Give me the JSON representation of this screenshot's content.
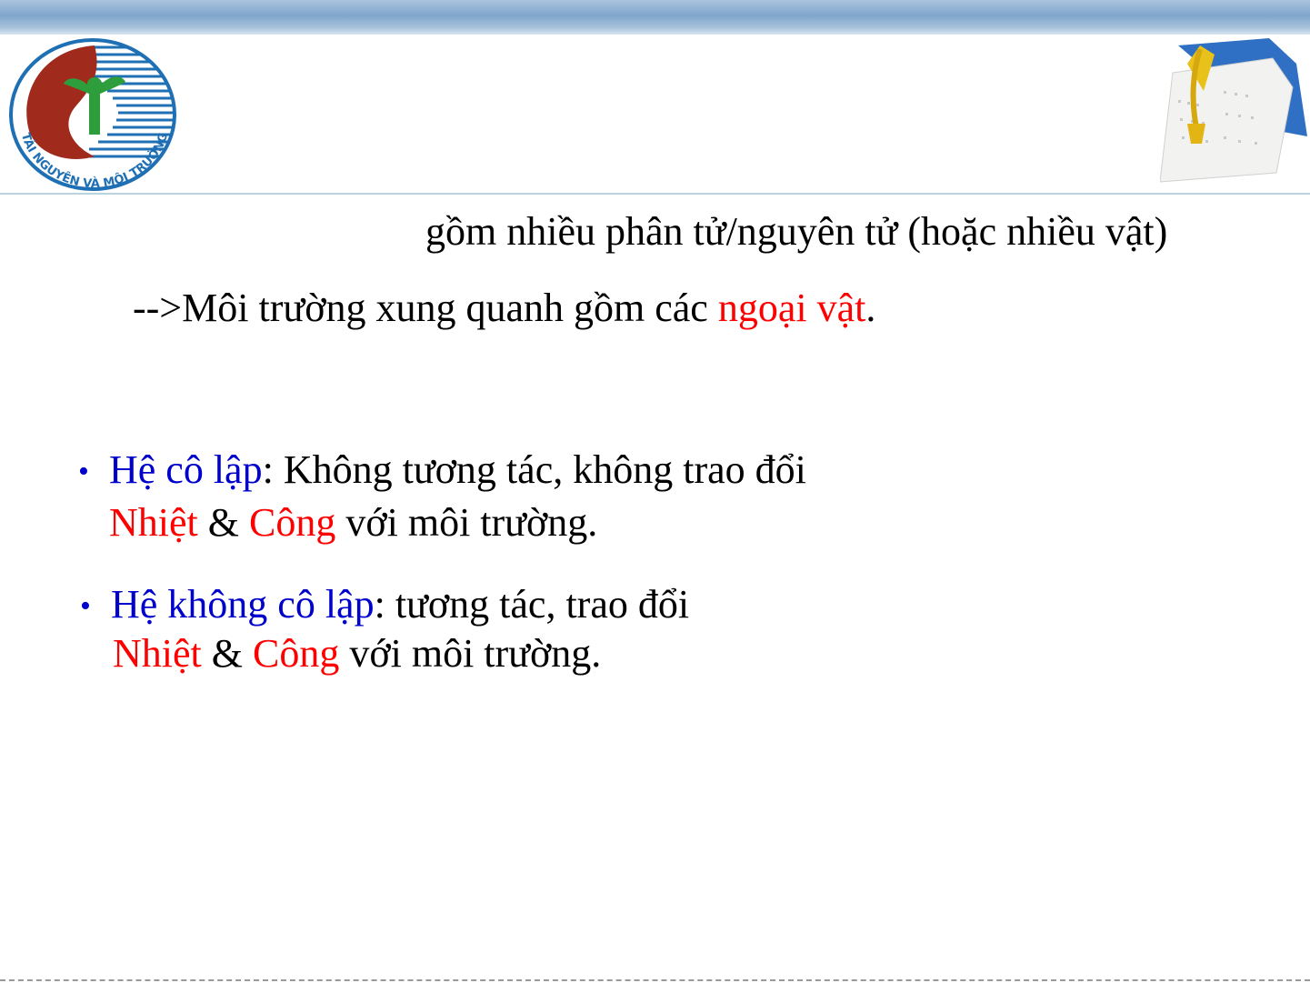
{
  "logo": {
    "text": "TÀI NGUYÊN VÀ MÔI TRƯỜNG",
    "colors": {
      "red": "#a02a1c",
      "blue": "#1f6fb4",
      "green": "#2e9e3c"
    }
  },
  "line1": {
    "text": "gồm nhiều phân tử/nguyên tử (hoặc nhiều vật)"
  },
  "line2": {
    "prefix": "-->Môi trường xung quanh gồm các ",
    "highlight": "ngoại vật",
    "suffix": "."
  },
  "bullet1": {
    "term": "Hệ cô lập",
    "rest": ": Không tương tác, không trao đổi",
    "w1": "Nhiệt",
    "amp": " & ",
    "w2": "Công",
    "tail": " với môi trường."
  },
  "bullet2": {
    "term": "Hệ không cô lập",
    "rest": ": tương tác, trao đổi",
    "w1": "Nhiệt",
    "amp": " & ",
    "w2": "Công",
    "tail": " với môi trường."
  },
  "colors": {
    "accent_red": "#ff0000",
    "accent_blue": "#0000cc",
    "header_band": "#7fa6cc"
  }
}
